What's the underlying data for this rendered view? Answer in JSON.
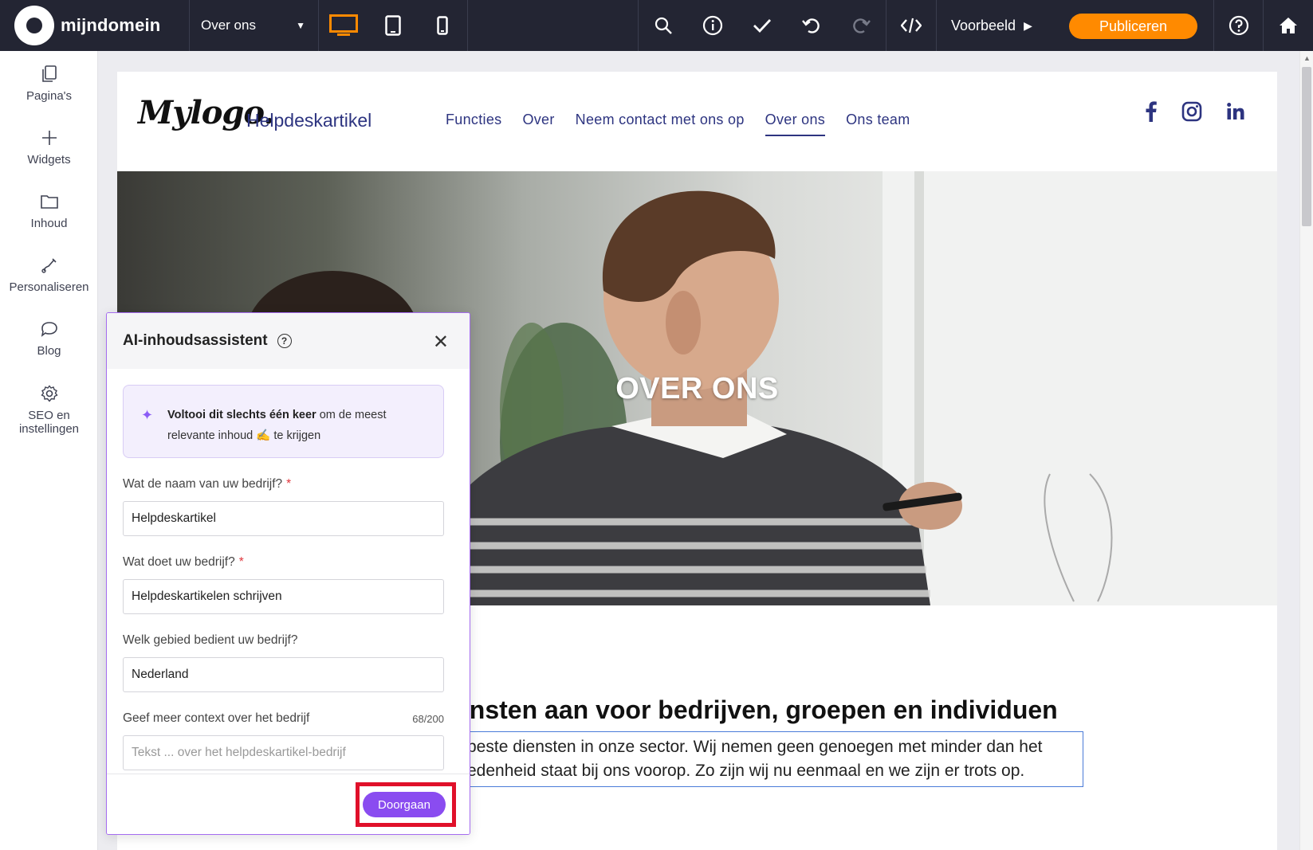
{
  "topbar": {
    "brand": "mijndomein",
    "page_select": "Over ons",
    "preview": "Voorbeeld",
    "publish": "Publiceren",
    "accent": "#ff8a00"
  },
  "sidebar": {
    "items": [
      {
        "label": "Pagina's",
        "icon": "pages-icon"
      },
      {
        "label": "Widgets",
        "icon": "plus-icon"
      },
      {
        "label": "Inhoud",
        "icon": "folder-icon"
      },
      {
        "label": "Personaliseren",
        "icon": "brush-icon"
      },
      {
        "label": "Blog",
        "icon": "chat-bubble-icon"
      },
      {
        "label": "SEO en instellingen",
        "icon": "gear-icon"
      }
    ]
  },
  "site": {
    "logo": "Mylogo.",
    "name": "Helpdeskartikel",
    "nav": [
      "Functies",
      "Over",
      "Neem contact met ons op",
      "Over ons",
      "Ons team"
    ],
    "active_nav": "Over ons",
    "hero_title": "OVER ONS",
    "heading_fragment": "ensten aan voor bedrijven, groepen en individuen",
    "text_line1": "beste diensten in onze sector. Wij nemen geen genoegen met minder dan het",
    "text_line2": "edenheid staat bij ons voorop. Zo zijn wij nu eenmaal en we zijn er trots op."
  },
  "ai": {
    "title": "AI-inhoudsassistent",
    "tip_bold": "Voltooi dit slechts één keer",
    "tip_rest1": " om de meest",
    "tip_rest2": "relevante inhoud ✍ te krijgen",
    "q1": "Wat de naam van uw bedrijf?",
    "a1": "Helpdeskartikel",
    "q2": "Wat doet uw bedrijf?",
    "a2": "Helpdeskartikelen schrijven",
    "q3": "Welk gebied bedient uw bedrijf?",
    "a3": "Nederland",
    "q4": "Geef meer context over het bedrijf",
    "q4_count": "68/200",
    "q4_partial": "Tekst ... over het helpdeskartikel-bedrijf",
    "button": "Doorgaan",
    "highlight_color": "#e0102a",
    "button_color": "#8a4cf0"
  }
}
